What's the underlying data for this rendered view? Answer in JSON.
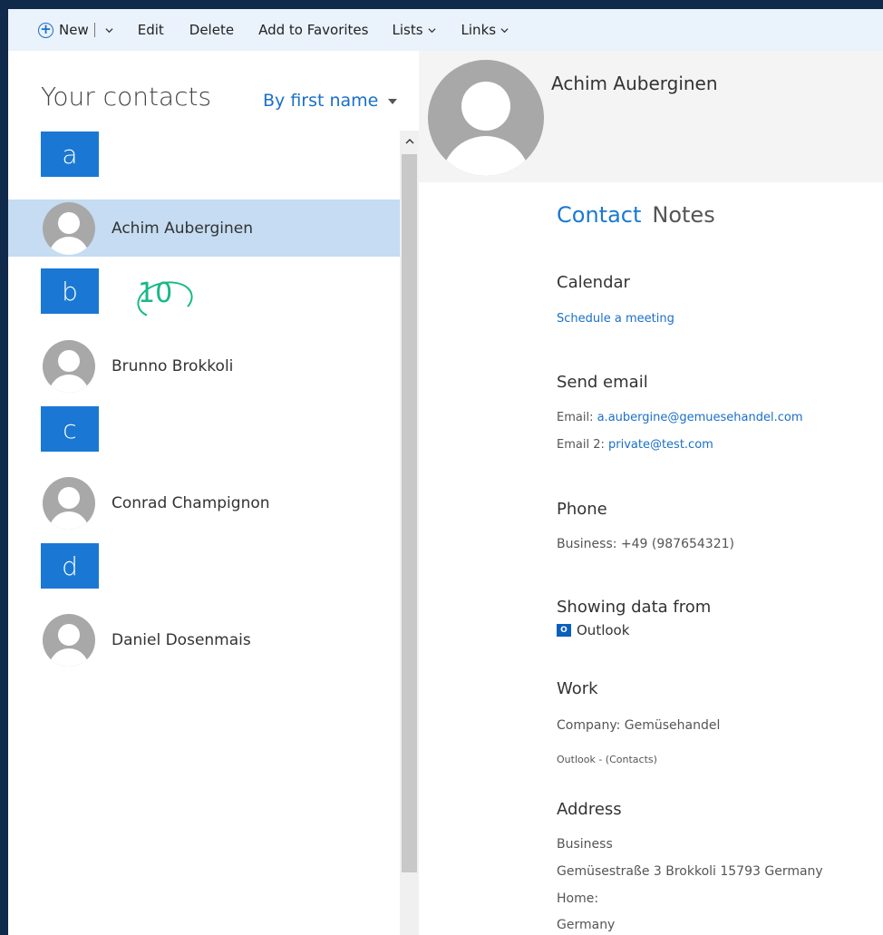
{
  "toolbar": {
    "new_label": "New",
    "edit_label": "Edit",
    "delete_label": "Delete",
    "favorites_label": "Add to Favorites",
    "lists_label": "Lists",
    "links_label": "Links"
  },
  "left": {
    "title": "Your contacts",
    "sort_label": "By first name",
    "groups": [
      {
        "letter": "a",
        "contact": "Achim Auberginen"
      },
      {
        "letter": "b",
        "contact": "Brunno Brokkoli"
      },
      {
        "letter": "c",
        "contact": "Conrad Champignon"
      },
      {
        "letter": "d",
        "contact": "Daniel Dosenmais"
      }
    ],
    "annotation": "10"
  },
  "detail": {
    "name": "Achim Auberginen",
    "tab_contact": "Contact",
    "tab_notes": "Notes",
    "calendar_title": "Calendar",
    "schedule_link": "Schedule a meeting",
    "email_title": "Send email",
    "email_label": "Email:",
    "email_value": "a.aubergine@gemuesehandel.com",
    "email2_label": "Email 2:",
    "email2_value": "private@test.com",
    "phone_title": "Phone",
    "phone_label": "Business:",
    "phone_value": "+49 (987654321)",
    "source_title": "Showing data from",
    "source_value": "Outlook",
    "work_title": "Work",
    "company_label": "Company:",
    "company_value": "Gemüsehandel",
    "work_source": "Outlook - (Contacts)",
    "address_title": "Address",
    "business_label": "Business",
    "business_address": "Gemüsestraße 3 Brokkoli 15793 Germany",
    "home_label": "Home:",
    "home_address": "Germany"
  },
  "colors": {
    "accent": "#1a78d4",
    "selected_row": "#c5dcf2",
    "annotation": "#19b886"
  }
}
